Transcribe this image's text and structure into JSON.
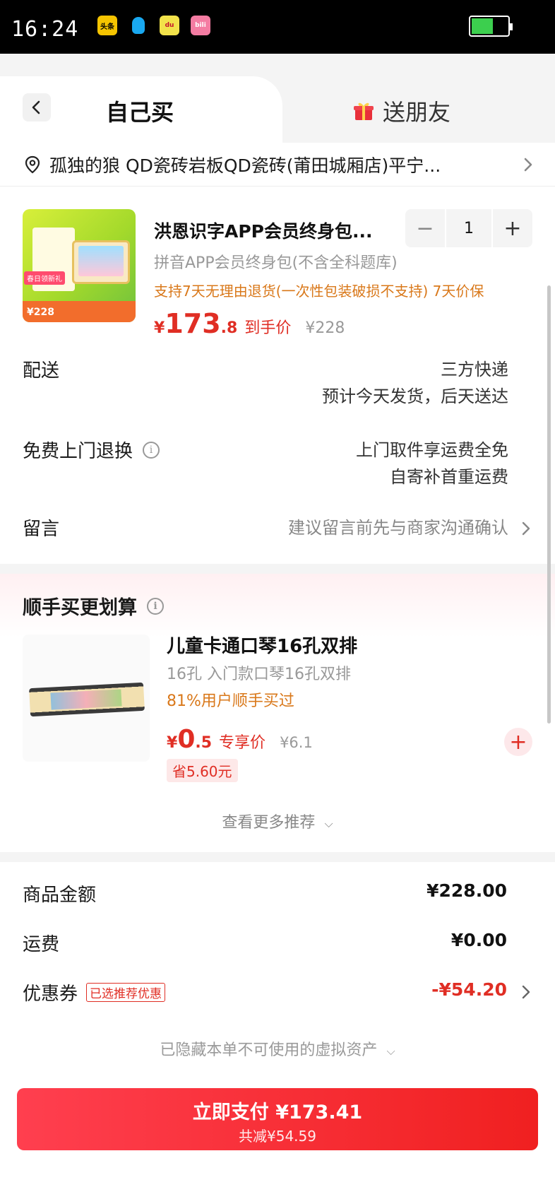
{
  "status_bar": {
    "time": "16:24",
    "app_icons": [
      "toutiao-icon",
      "qq-icon",
      "dewu-icon",
      "bilibili-icon"
    ],
    "icon_labels": {
      "toutiao": "头条",
      "dewu": "du",
      "bilibili": "bili"
    },
    "battery_level": 0.6
  },
  "tabs": {
    "self": "自己买",
    "gift": "送朋友"
  },
  "address": {
    "text": "孤独的狼 QD瓷砖岩板QD瓷砖(莆田城厢店)平宁..."
  },
  "product": {
    "title": "洪恩识字APP会员终身包...",
    "sku": "拼音APP会员终身包(不含全科题库)",
    "policy": "支持7天无理由退货(一次性包装破损不支持) 7天价保",
    "price_currency": "¥",
    "price_int": "173",
    "price_dec": ".8",
    "price_label": "到手价",
    "original_price": "¥228",
    "quantity": "1",
    "image_badge": "春日领新礼",
    "image_price": "¥228"
  },
  "rows": {
    "delivery_label": "配送",
    "delivery_line1": "三方快递",
    "delivery_line2": "预计今天发货，后天送达",
    "return_label": "免费上门退换",
    "return_line1": "上门取件享运费全免",
    "return_line2": "自寄补首重运费",
    "message_label": "留言",
    "message_hint": "建议留言前先与商家沟通确认"
  },
  "recommend": {
    "title": "顺手买更划算",
    "item_name": "儿童卡通口琴16孔双排",
    "item_sku": "16孔 入门款口琴16孔双排",
    "item_stat": "81%用户顺手买过",
    "price_currency": "¥",
    "price_int": "0",
    "price_dec": ".5",
    "price_label": "专享价",
    "original_price": "¥6.1",
    "save_text": "省5.60元",
    "more_label": "查看更多推荐"
  },
  "summary": {
    "goods_label": "商品金额",
    "goods_value": "¥228.00",
    "shipping_label": "运费",
    "shipping_value": "¥0.00",
    "coupon_label": "优惠券",
    "coupon_tag": "已选推荐优惠",
    "coupon_value": "-¥54.20",
    "hidden_assets": "已隐藏本单不可使用的虚拟资产"
  },
  "pay": {
    "main": "立即支付 ¥173.41",
    "sub": "共减¥54.59"
  },
  "colors": {
    "accent_red": "#e02e24",
    "orange": "#d9781a",
    "pay_gradient_start": "#ff3f4f",
    "pay_gradient_end": "#f02020"
  }
}
